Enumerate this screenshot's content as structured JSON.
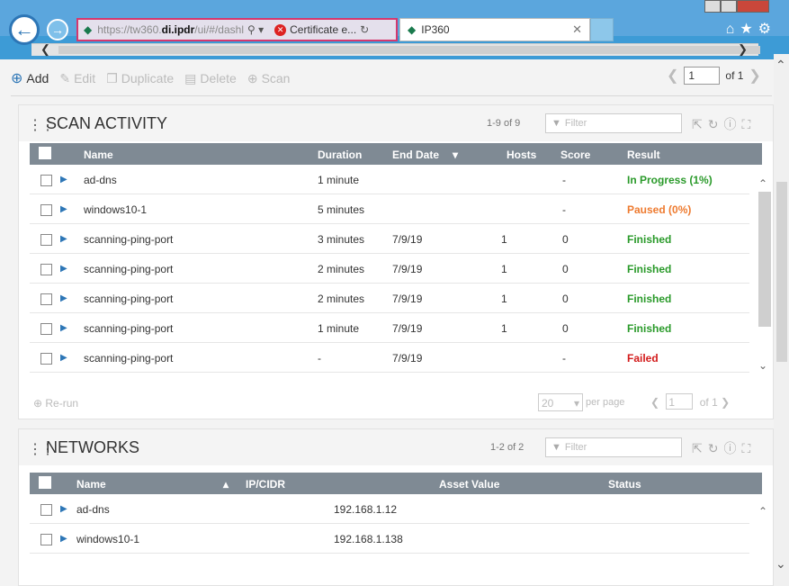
{
  "browser": {
    "url_prefix": "https://tw360.",
    "url_domain": "di.ipdr",
    "url_suffix": "/ui/#/dashl",
    "cert_text": "Certificate e...",
    "tab_title": "IP360"
  },
  "toolbar": {
    "add": "Add",
    "edit": "Edit",
    "duplicate": "Duplicate",
    "delete": "Delete",
    "scan": "Scan",
    "page_value": "1",
    "page_of": "of 1"
  },
  "scan_activity": {
    "title": "SCAN ACTIVITY",
    "count": "1-9 of 9",
    "filter_placeholder": "Filter",
    "columns": {
      "name": "Name",
      "duration": "Duration",
      "end_date": "End Date",
      "hosts": "Hosts",
      "score": "Score",
      "result": "Result"
    },
    "rows": [
      {
        "name": "ad-dns",
        "duration": "1 minute",
        "end_date": "",
        "hosts": "",
        "score": "-",
        "result": "In Progress (1%)",
        "status": "green"
      },
      {
        "name": "windows10-1",
        "duration": "5 minutes",
        "end_date": "",
        "hosts": "",
        "score": "-",
        "result": "Paused (0%)",
        "status": "orange"
      },
      {
        "name": "scanning-ping-port",
        "duration": "3 minutes",
        "end_date": "7/9/19",
        "hosts": "1",
        "score": "0",
        "result": "Finished",
        "status": "green"
      },
      {
        "name": "scanning-ping-port",
        "duration": "2 minutes",
        "end_date": "7/9/19",
        "hosts": "1",
        "score": "0",
        "result": "Finished",
        "status": "green"
      },
      {
        "name": "scanning-ping-port",
        "duration": "2 minutes",
        "end_date": "7/9/19",
        "hosts": "1",
        "score": "0",
        "result": "Finished",
        "status": "green"
      },
      {
        "name": "scanning-ping-port",
        "duration": "1 minute",
        "end_date": "7/9/19",
        "hosts": "1",
        "score": "0",
        "result": "Finished",
        "status": "green"
      },
      {
        "name": "scanning-ping-port",
        "duration": "-",
        "end_date": "7/9/19",
        "hosts": "",
        "score": "-",
        "result": "Failed",
        "status": "red"
      }
    ],
    "footer": {
      "rerun": "Re-run",
      "page_size": "20",
      "per_page": "per page",
      "page_value": "1",
      "page_of": "of 1"
    }
  },
  "networks": {
    "title": "NETWORKS",
    "count": "1-2 of 2",
    "filter_placeholder": "Filter",
    "columns": {
      "name": "Name",
      "ip": "IP/CIDR",
      "asset_value": "Asset Value",
      "status": "Status"
    },
    "rows": [
      {
        "name": "ad-dns",
        "ip": "192.168.1.12"
      },
      {
        "name": "windows10-1",
        "ip": "192.168.1.138"
      }
    ]
  },
  "colors": {
    "chrome_blue": "#3d9bd6",
    "header_gray": "#7f8a94",
    "finished_green": "#2a9a2a",
    "paused_orange": "#ee7b30",
    "failed_red": "#d31c1c"
  }
}
